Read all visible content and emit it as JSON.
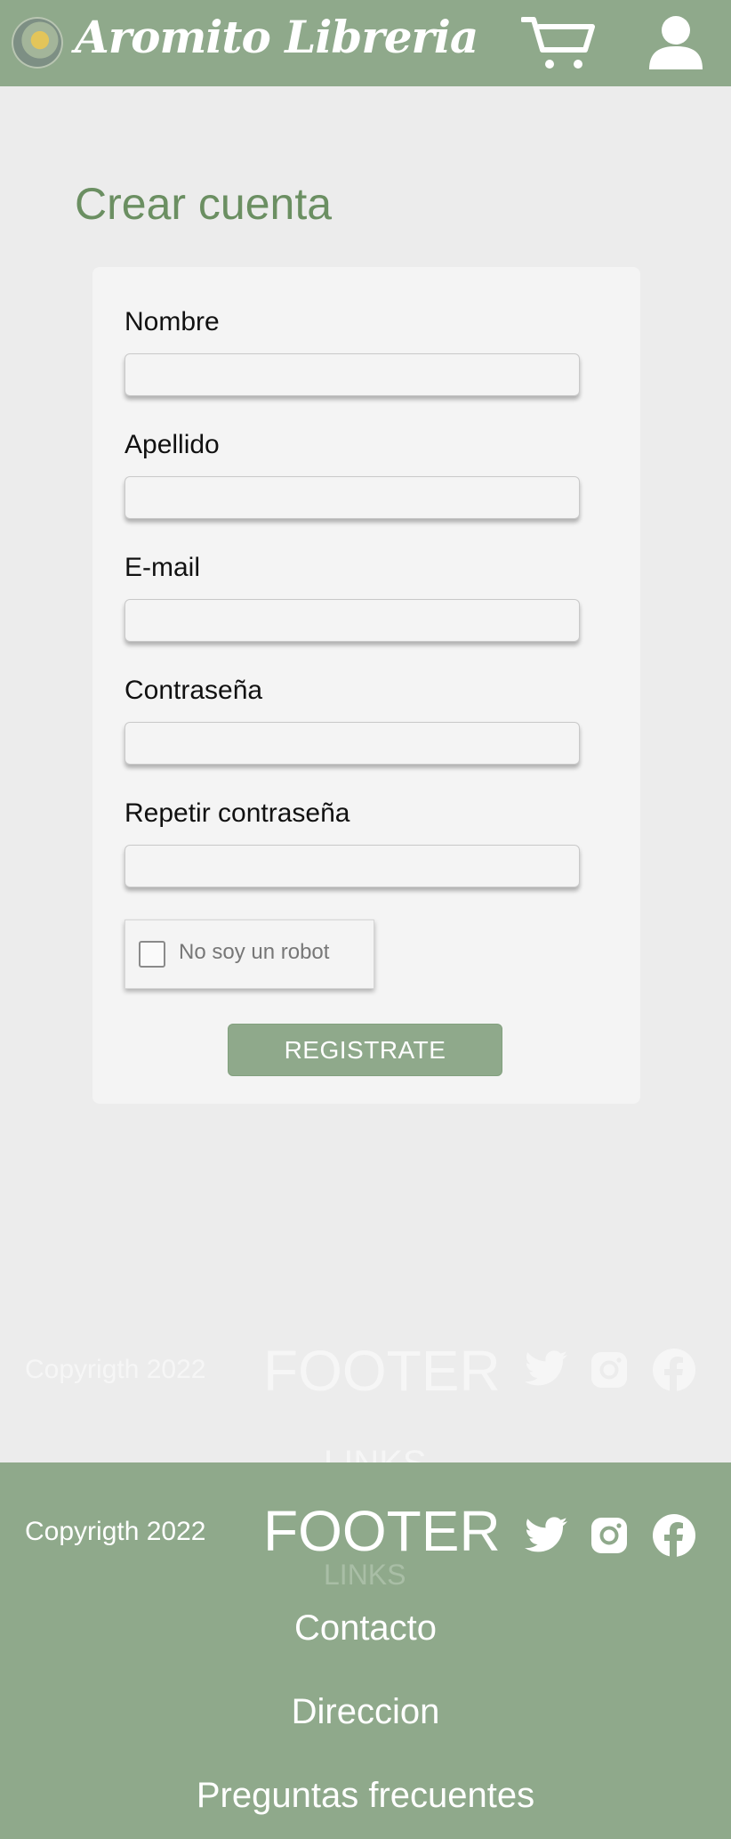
{
  "header": {
    "brand": "Aromito Libreria",
    "logo_icon": "book-flower-logo",
    "cart_icon": "cart-icon",
    "user_icon": "user-icon"
  },
  "page": {
    "title": "Crear cuenta"
  },
  "form": {
    "fields": [
      {
        "label": "Nombre",
        "value": "",
        "placeholder": ""
      },
      {
        "label": "Apellido",
        "value": "",
        "placeholder": ""
      },
      {
        "label": "E-mail",
        "value": "",
        "placeholder": ""
      },
      {
        "label": "Contraseña",
        "value": "",
        "placeholder": ""
      },
      {
        "label": "Repetir contraseña",
        "value": "",
        "placeholder": ""
      }
    ],
    "captcha_label": "No soy un robot",
    "submit_label": "REGISTRATE"
  },
  "footer": {
    "copyright": "Copyrigth 2022",
    "title": "FOOTER",
    "links_heading": "LINKS",
    "links": [
      "Contacto",
      "Direccion",
      "Preguntas frecuentes"
    ],
    "social": [
      "twitter-icon",
      "instagram-icon",
      "facebook-icon"
    ]
  },
  "colors": {
    "brand_green": "#8fa98b",
    "title_green": "#6b8f62",
    "page_bg": "#ececec",
    "card_bg": "#f4f4f4"
  }
}
